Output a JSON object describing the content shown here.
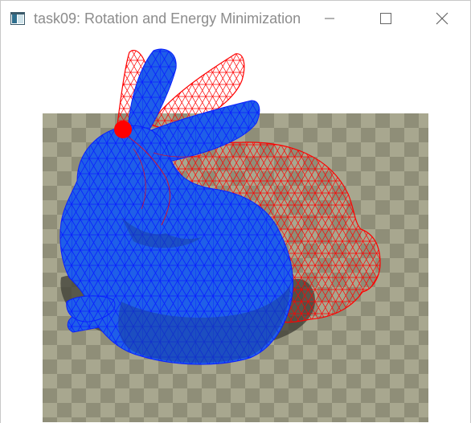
{
  "window": {
    "title": "task09: Rotation and Energy Minimization",
    "icon": "app-window-icon",
    "controls": [
      "minimize-icon",
      "maximize-icon",
      "close-icon"
    ]
  },
  "scene": {
    "floor_colors": [
      "#8f8e78",
      "#a8a78f"
    ],
    "mesh_color": "#1f5fe8",
    "mesh_edge_color": "#0a1fff",
    "wireframe_color": "#ff0000",
    "shadow_color": "#3e3d35",
    "handle_color": "#ff0000"
  }
}
